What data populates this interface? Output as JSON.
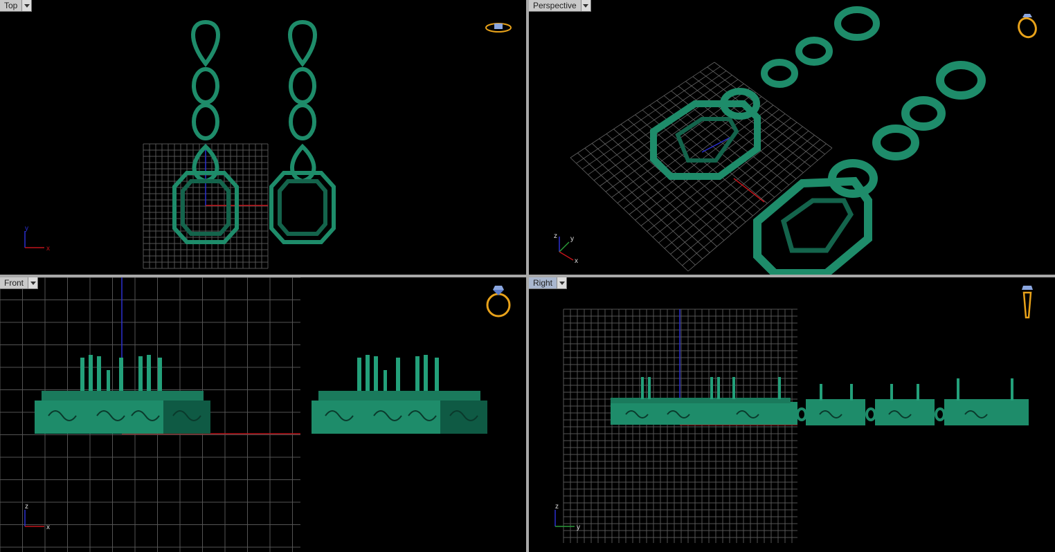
{
  "viewports": {
    "top": {
      "title": "Top",
      "axis_labels": [
        "y",
        "x"
      ],
      "widget_icon": "ring-top-view-icon"
    },
    "perspective": {
      "title": "Perspective",
      "axis_labels": [
        "z",
        "y",
        "x"
      ],
      "widget_icon": "ring-perspective-icon"
    },
    "front": {
      "title": "Front",
      "axis_labels": [
        "z",
        "x"
      ],
      "widget_icon": "ring-front-view-icon"
    },
    "right": {
      "title": "Right",
      "axis_labels": [
        "z",
        "y"
      ],
      "widget_icon": "ring-side-view-icon"
    }
  },
  "active_viewport": "right",
  "colors": {
    "model": "#1e8c6a",
    "model_dark": "#0f5a44",
    "grid": "#5a5a5a",
    "x_axis": "#c0141a",
    "y_axis": "#2a2fd0",
    "z_axis": "#2a2fd0",
    "widget": "#e8a21a"
  }
}
